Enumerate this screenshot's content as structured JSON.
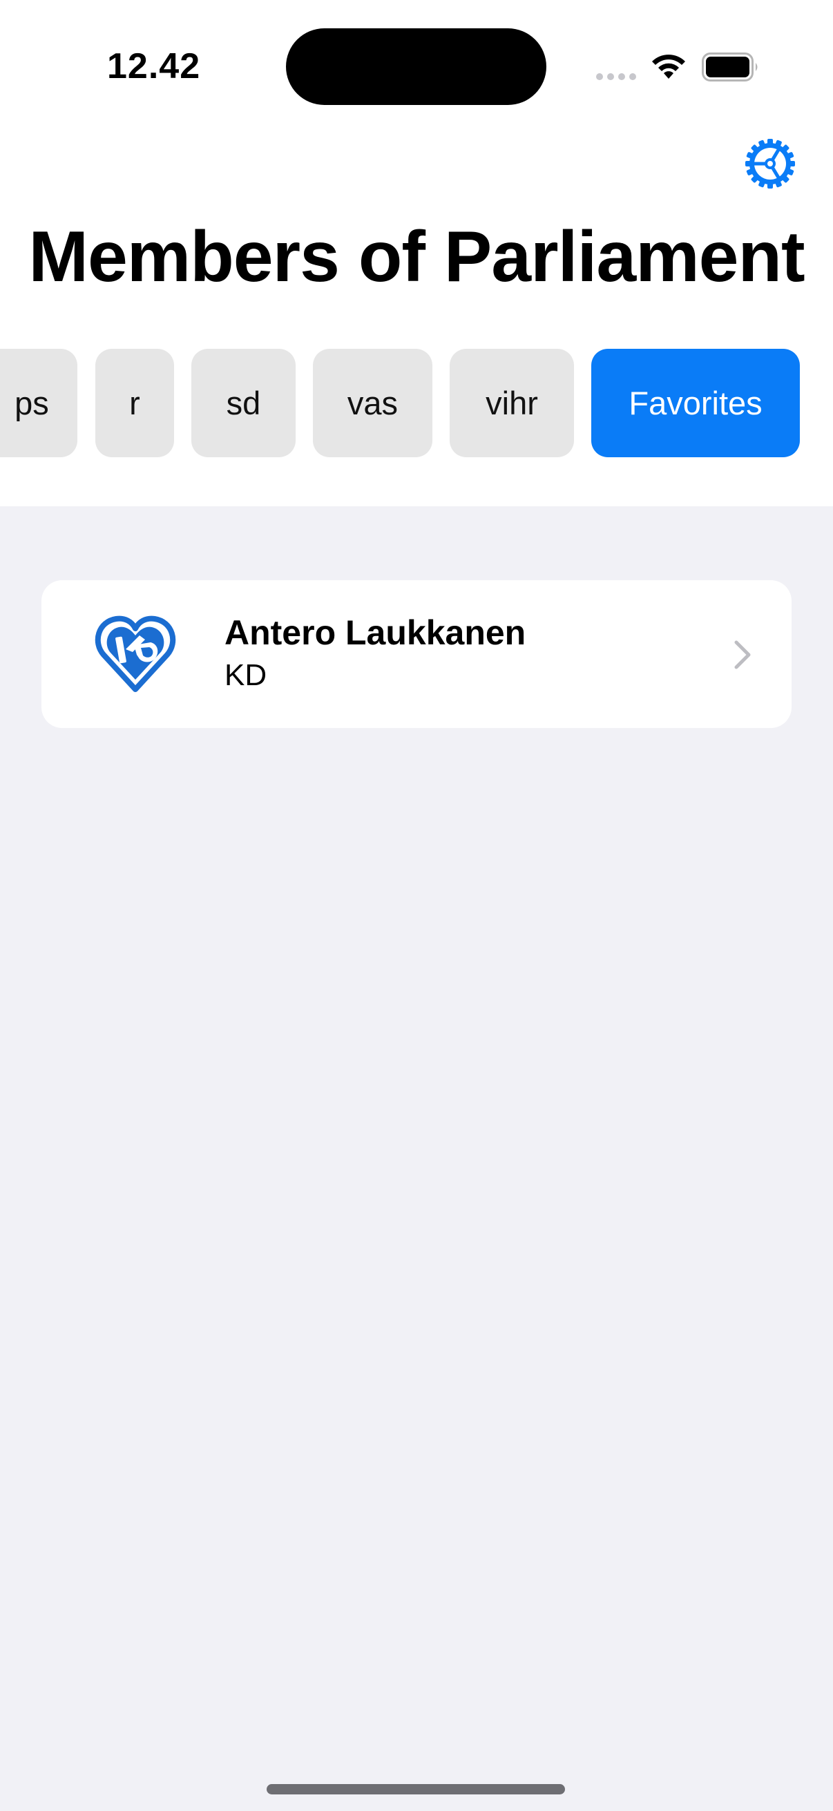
{
  "status_bar": {
    "time": "12.42",
    "icons": [
      "signal-dots-icon",
      "wifi-icon",
      "battery-icon"
    ]
  },
  "header": {
    "settings_icon": "gear-icon",
    "title": "Members of Parliament"
  },
  "filters": {
    "chips": [
      {
        "label": "ps",
        "selected": false
      },
      {
        "label": "r",
        "selected": false
      },
      {
        "label": "sd",
        "selected": false
      },
      {
        "label": "vas",
        "selected": false
      },
      {
        "label": "vihr",
        "selected": false
      },
      {
        "label": "Favorites",
        "selected": true
      }
    ],
    "colors": {
      "chip_bg": "#e6e6e6",
      "chip_selected_bg": "#0a7cf7"
    }
  },
  "members": [
    {
      "name": "Antero Laukkanen",
      "party": "KD",
      "logo_icon": "kd-heart-logo-icon",
      "logo_color": "#1b6dd1",
      "disclosure_icon": "chevron-right-icon"
    }
  ],
  "colors": {
    "accent": "#0a7cf7",
    "background": "#f1f1f6"
  }
}
